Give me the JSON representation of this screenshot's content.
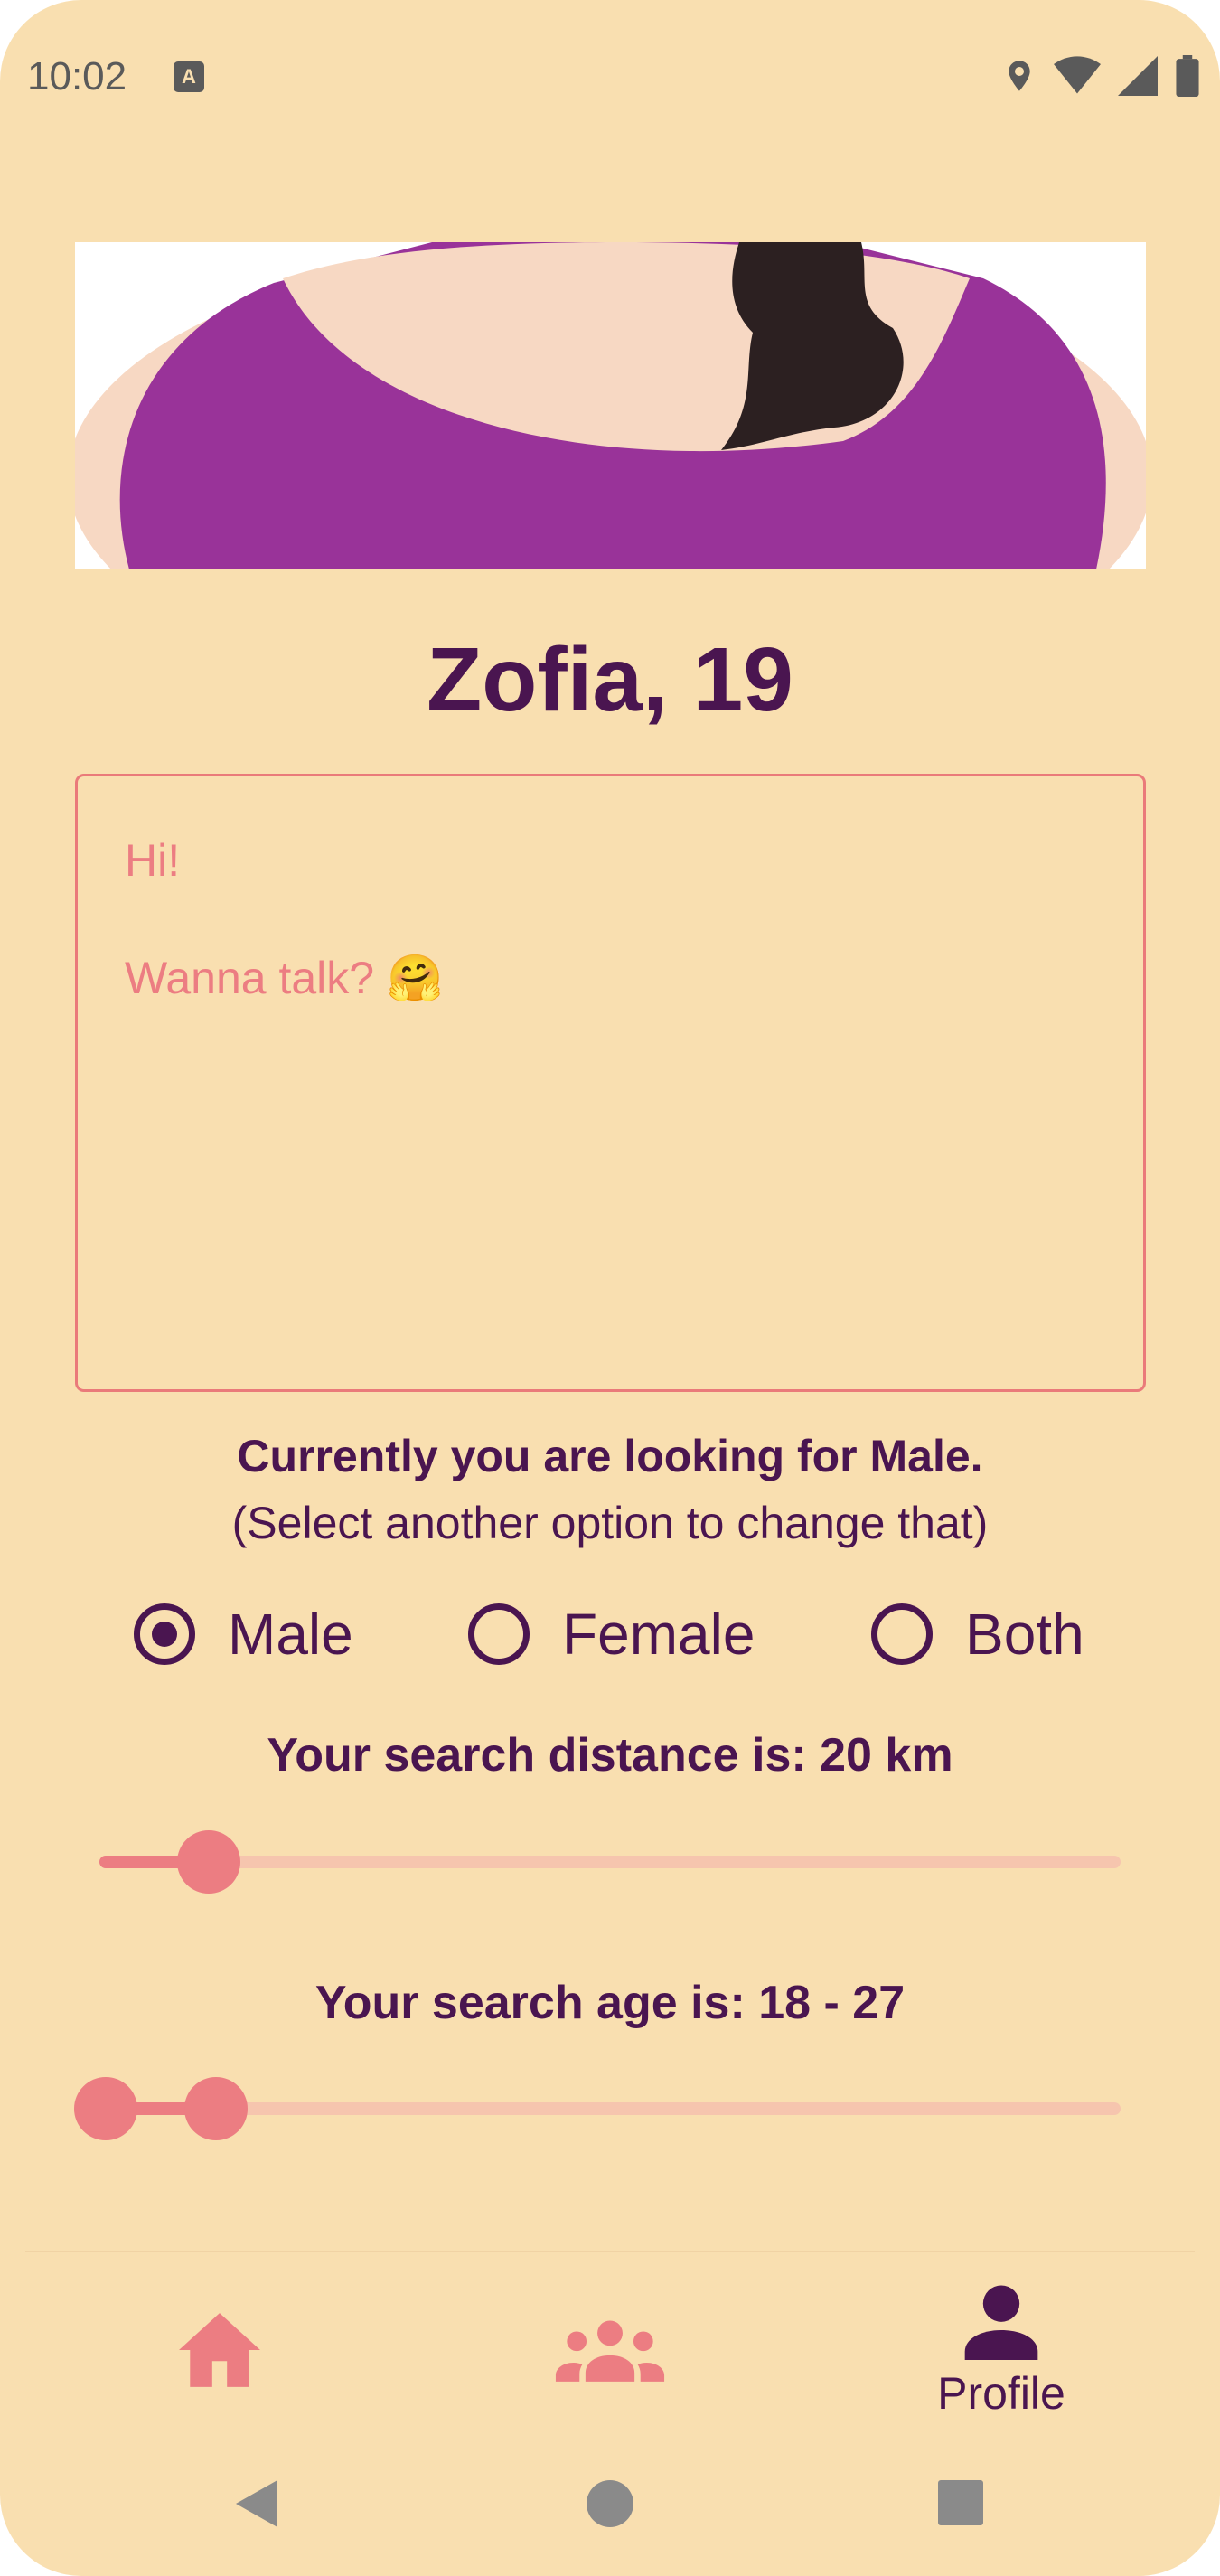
{
  "status_bar": {
    "time": "10:02",
    "notification_icon": "a-box-icon",
    "icons": [
      "location-icon",
      "wifi-icon",
      "signal-icon",
      "battery-icon"
    ]
  },
  "profile": {
    "name_age": "Zofia, 19",
    "bio_lines": [
      "Hi!",
      "",
      "Wanna talk? 🤗"
    ]
  },
  "preference": {
    "looking_for": "Currently you are looking for Male.",
    "hint": "(Select another option to change that)",
    "options": [
      {
        "label": "Male",
        "checked": true
      },
      {
        "label": "Female",
        "checked": false
      },
      {
        "label": "Both",
        "checked": false
      }
    ]
  },
  "distance": {
    "label": "Your search distance is: 20 km",
    "value_fraction": 0.11
  },
  "age_range": {
    "label": "Your search age is: 18 - 27",
    "low_fraction": 0.0,
    "high_fraction": 0.11
  },
  "bottom_nav": {
    "items": [
      {
        "icon": "home-icon",
        "label": "",
        "active": false
      },
      {
        "icon": "people-icon",
        "label": "",
        "active": false
      },
      {
        "icon": "person-icon",
        "label": "Profile",
        "active": true
      }
    ]
  },
  "system_nav": [
    "back-icon",
    "home-circle-icon",
    "recents-icon"
  ],
  "colors": {
    "background": "#f9dfb0",
    "primary": "#4a1550",
    "accent": "#ec7d82",
    "track": "#f6c5ae"
  }
}
